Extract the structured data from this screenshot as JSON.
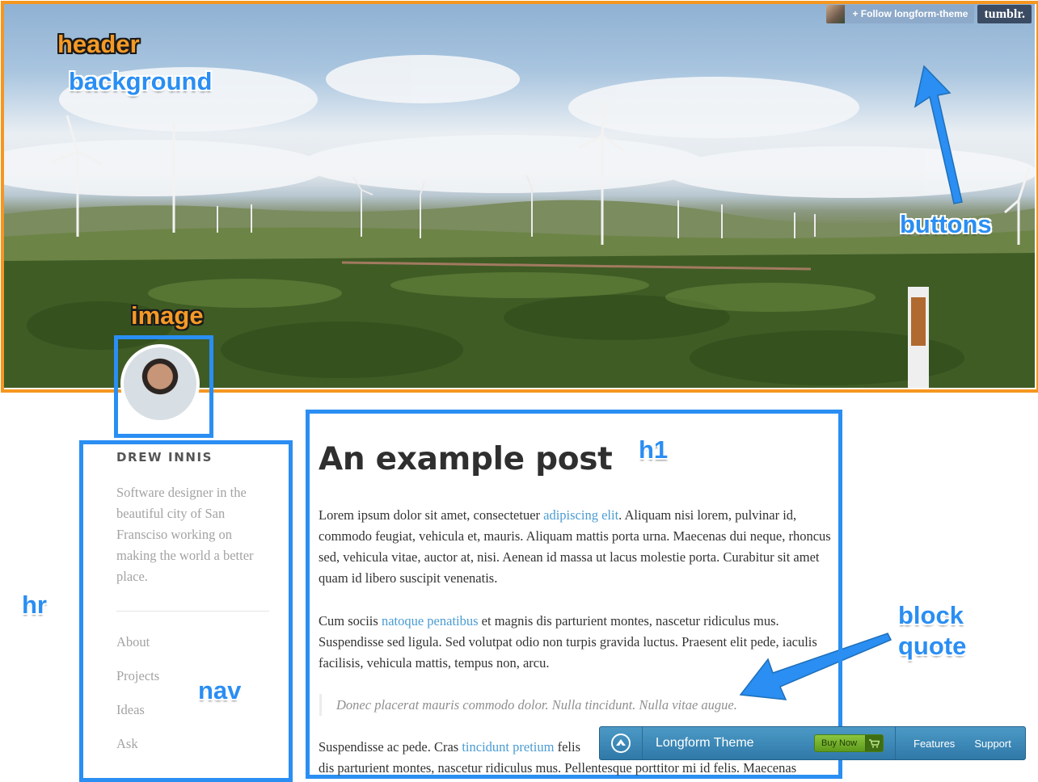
{
  "header": {
    "follow_label": "+ Follow longform-theme",
    "tumblr_logo": "tumblr."
  },
  "annotations": {
    "header": "header",
    "background": "background",
    "image": "image",
    "buttons": "buttons",
    "hr": "hr",
    "nav": "nav",
    "h1": "h1",
    "block_quote_line1": "block",
    "block_quote_line2": "quote"
  },
  "sidebar": {
    "name": "DREW INNIS",
    "bio": "Software designer in the beautiful city of San Fransciso working on making the world a better place.",
    "nav": [
      "About",
      "Projects",
      "Ideas",
      "Ask"
    ]
  },
  "post": {
    "title": "An example post",
    "p1_a": "Lorem ipsum dolor sit amet, consectetuer ",
    "p1_link": "adipiscing elit",
    "p1_b": ". Aliquam nisi lorem, pulvinar id, commodo feugiat, vehicula et, mauris. Aliquam mattis porta urna. Maecenas dui neque, rhoncus sed, vehicula vitae, auctor at, nisi. Aenean id massa ut lacus molestie porta. Curabitur sit amet quam id libero suscipit venenatis.",
    "p2_a": "Cum sociis ",
    "p2_link": "natoque penatibus",
    "p2_b": " et magnis dis parturient montes, nascetur ridiculus mus. Suspendisse sed ligula. Sed volutpat odio non turpis gravida luctus. Praesent elit pede, iaculis facilisis, vehicula mattis, tempus non, arcu.",
    "quote": "Donec placerat mauris commodo dolor. Nulla tincidunt. Nulla vitae augue.",
    "p3_a": "Suspendisse ac pede. Cras ",
    "p3_link": "tincidunt pretium",
    "p3_b": " felis",
    "p3_line2": "dis parturient montes, nascetur ridiculus mus. Pellentesque porttitor mi id felis. Maecenas"
  },
  "promo": {
    "title": "Longform Theme",
    "buy": "Buy Now",
    "features": "Features",
    "support": "Support"
  },
  "colors": {
    "annotation_orange": "#f5961f",
    "annotation_blue": "#2a8ef3",
    "link": "#4b9cd3"
  }
}
